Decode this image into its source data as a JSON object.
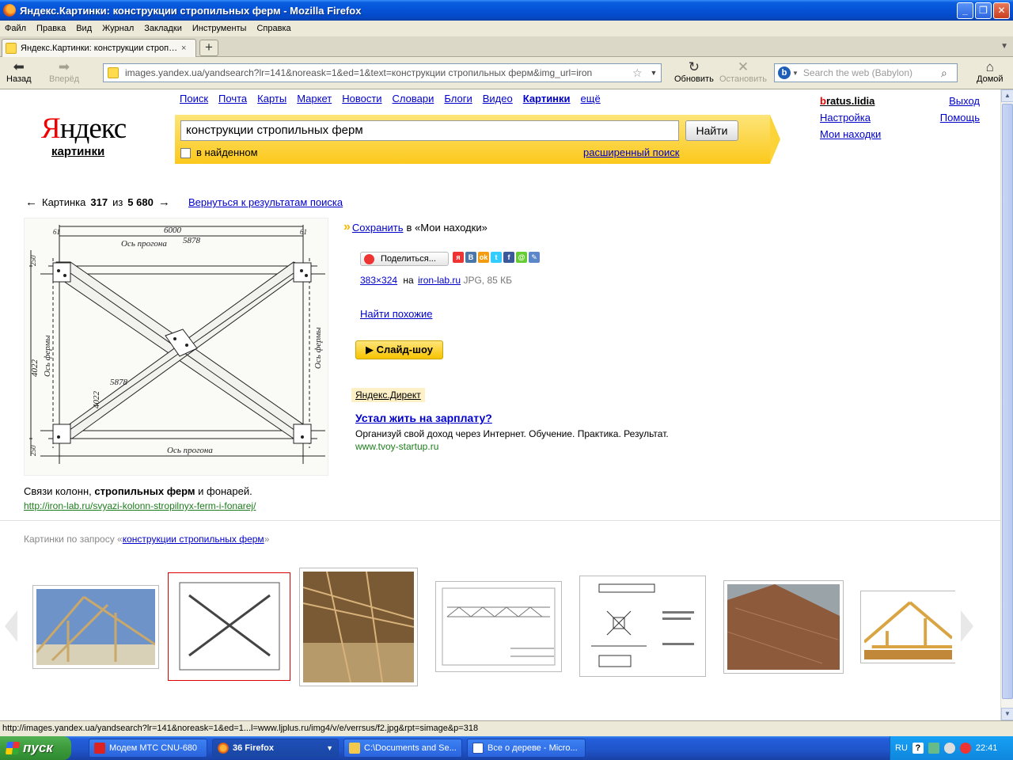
{
  "window": {
    "title": "Яндекс.Картинки: конструкции стропильных ферм - Mozilla Firefox"
  },
  "menu": [
    "Файл",
    "Правка",
    "Вид",
    "Журнал",
    "Закладки",
    "Инструменты",
    "Справка"
  ],
  "tab": {
    "label": "Яндекс.Картинки: конструкции стропильн...",
    "close": "×",
    "new": "+"
  },
  "nav": {
    "back": "Назад",
    "forward": "Вперёд",
    "reload": "Обновить",
    "stop": "Остановить",
    "home": "Домой",
    "url": "images.yandex.ua/yandsearch?lr=141&noreask=1&ed=1&text=конструкции стропильных ферм&img_url=iron",
    "search_placeholder": "Search the web (Babylon)"
  },
  "yandex": {
    "logo_first": "Я",
    "logo_rest": "ндекс",
    "logo_sub": "картинки",
    "services": [
      "Поиск",
      "Почта",
      "Карты",
      "Маркет",
      "Новости",
      "Словари",
      "Блоги",
      "Видео",
      "Картинки",
      "ещё"
    ],
    "query": "конструкции стропильных ферм",
    "find_button": "Найти",
    "within_found": "в найденном",
    "advanced": "расширенный поиск",
    "user_first": "b",
    "user_rest": "ratus.lidia",
    "settings": "Настройка",
    "my_finds": "Мои находки",
    "logout": "Выход",
    "help": "Помощь"
  },
  "picture": {
    "prev_arrow": "←",
    "label": "Картинка",
    "index": "317",
    "of": "из",
    "total": "5 680",
    "next_arrow": "→",
    "back_to_results": "Вернуться к результатам поиска",
    "save_link": "Сохранить",
    "save_rest": "в «Мои находки»",
    "share": "Поделиться...",
    "dims": "383×324",
    "on": "на",
    "site": "iron-lab.ru",
    "meta": "JPG, 85 КБ",
    "similar": "Найти похожие",
    "slideshow": "▶ Слайд-шоу",
    "caption_a": "Связи колонн, ",
    "caption_b": "стропильных ферм",
    "caption_c": " и фонарей.",
    "source_url": "http://iron-lab.ru/svyazi-kolonn-stropilnyx-ferm-i-fonarej/",
    "drawing_labels": {
      "top": "6000",
      "sub": "5878",
      "left_a": "61",
      "right_a": "61",
      "axis_top": "Ось прогона",
      "axis_bottom": "Ось прогона",
      "axis_left": "Ось фермы",
      "axis_right": "Ось фермы",
      "height": "4022",
      "diag": "5878",
      "diag2": "4022",
      "small_l": "250",
      "small_b": "250"
    }
  },
  "ad": {
    "label": "Яндекс.Директ",
    "title": "Устал жить на зарплату?",
    "text": "Организуй свой доход через Интернет. Обучение. Практика. Результат.",
    "url": "www.tvoy-startup.ru"
  },
  "related": {
    "prefix": "Картинки по запросу «",
    "query": "конструкции стропильных ферм",
    "suffix": "»"
  },
  "statusbar": "http://images.yandex.ua/yandsearch?lr=141&noreask=1&ed=1...l=www.ljplus.ru/img4/v/e/verrsus/f2.jpg&rpt=simage&p=318",
  "taskbar": {
    "start": "пуск",
    "tasks": [
      "Модем МТС CNU-680",
      "36 Firefox",
      "C:\\Documents and Se...",
      "Все о дереве - Micro..."
    ],
    "lang": "RU",
    "clock": "22:41"
  }
}
